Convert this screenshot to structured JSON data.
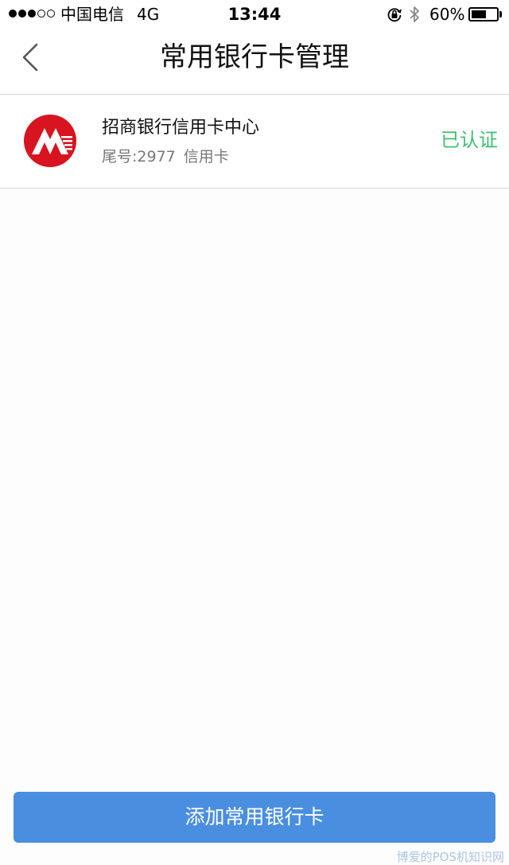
{
  "status_bar": {
    "carrier": "中国电信",
    "network": "4G",
    "time": "13:44",
    "battery": "60%",
    "battery_level": 0.6,
    "signal_strength": 3,
    "signal_max": 5
  },
  "nav": {
    "title": "常用银行卡管理",
    "back_icon": "chevron-left-icon"
  },
  "cards": [
    {
      "bank_name": "招商银行信用卡中心",
      "tail_label": "尾号:2977",
      "card_type": "信用卡",
      "status": "已认证",
      "logo_icon": "cmb-bank-logo"
    }
  ],
  "actions": {
    "add_card_label": "添加常用银行卡"
  },
  "watermark": "博爱的POS机知识网",
  "colors": {
    "accent_button": "#4a8ee0",
    "verified": "#3fbf6f",
    "logo_red": "#d7141f"
  }
}
